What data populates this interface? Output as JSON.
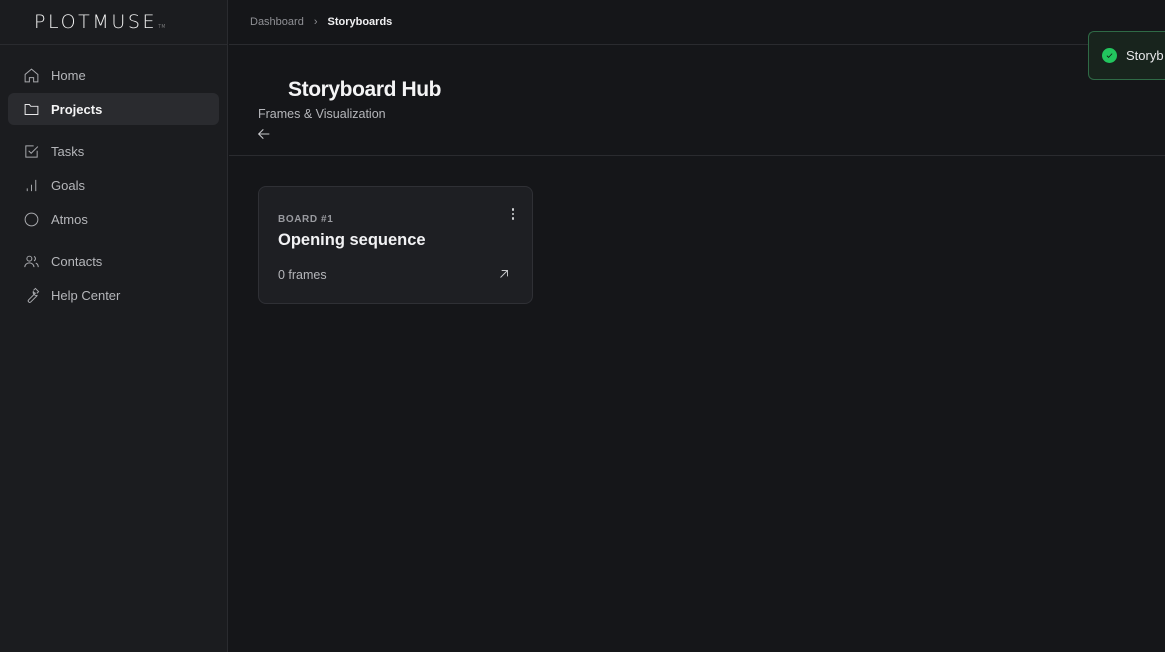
{
  "brand": {
    "logo_text": "PLOTMUSE",
    "trademark": "TM"
  },
  "sidebar": {
    "items": [
      {
        "label": "Home",
        "icon": "home-icon"
      },
      {
        "label": "Projects",
        "icon": "folder-icon",
        "active": true
      },
      {
        "label": "Tasks",
        "icon": "checkbox-icon"
      },
      {
        "label": "Goals",
        "icon": "bar-chart-icon"
      },
      {
        "label": "Atmos",
        "icon": "circle-icon"
      },
      {
        "label": "Contacts",
        "icon": "users-icon"
      },
      {
        "label": "Help Center",
        "icon": "wrench-icon"
      }
    ]
  },
  "breadcrumb": {
    "parent": "Dashboard",
    "separator": "›",
    "current": "Storyboards"
  },
  "header": {
    "title": "Storyboard Hub",
    "subtitle": "Frames & Visualization"
  },
  "boards": [
    {
      "label": "BOARD #1",
      "title": "Opening sequence",
      "meta": "0 frames"
    }
  ],
  "toast": {
    "text": "Storyb",
    "status": "success"
  },
  "colors": {
    "background": "#151619",
    "sidebar": "#1b1c1f",
    "card": "#1e1f23",
    "success": "#22c55e"
  }
}
